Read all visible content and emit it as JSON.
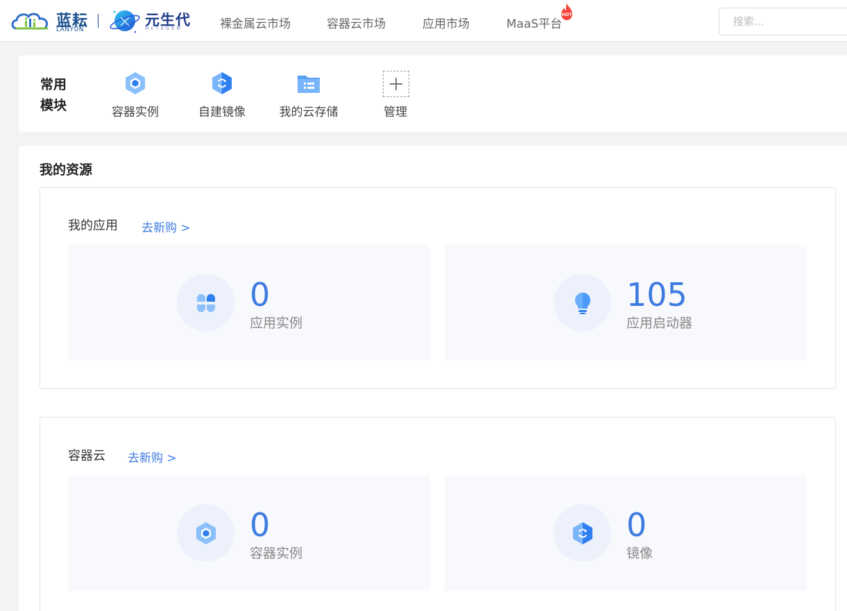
{
  "brand": {
    "lanyun_cn": "蓝耘",
    "lanyun_en": "LANYUN",
    "metagen_cn": "元生代",
    "metagen_en": "METAGEN"
  },
  "nav": [
    {
      "label": "裸金属云市场"
    },
    {
      "label": "容器云市场"
    },
    {
      "label": "应用市场"
    },
    {
      "label": "MaaS平台",
      "badge": "HOT"
    }
  ],
  "search": {
    "placeholder": "搜索...",
    "value": ""
  },
  "modules": {
    "title": "常用模块",
    "items": [
      {
        "label": "容器实例",
        "icon": "container-icon"
      },
      {
        "label": "自建镜像",
        "icon": "image-icon"
      },
      {
        "label": "我的云存储",
        "icon": "folder-icon"
      },
      {
        "label": "管理",
        "icon": "plus-icon"
      }
    ]
  },
  "resources": {
    "title": "我的资源",
    "groups": [
      {
        "title": "我的应用",
        "link": "去新购 >",
        "stats": [
          {
            "value": "0",
            "label": "应用实例",
            "icon": "clover-icon"
          },
          {
            "value": "105",
            "label": "应用启动器",
            "icon": "bulb-icon"
          }
        ]
      },
      {
        "title": "容器云",
        "link": "去新购 >",
        "stats": [
          {
            "value": "0",
            "label": "容器实例",
            "icon": "container-icon"
          },
          {
            "value": "0",
            "label": "镜像",
            "icon": "image-icon"
          }
        ]
      }
    ]
  },
  "colors": {
    "accent": "#3d7be0",
    "icon_blue": "#4a90f2",
    "brand_navy": "#1a4f8e",
    "hot": "#f5443a"
  }
}
